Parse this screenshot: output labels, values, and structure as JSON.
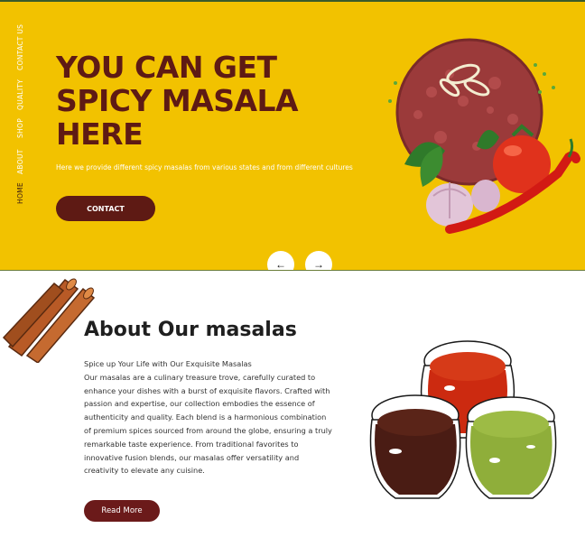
{
  "nav": {
    "items": [
      {
        "label": "HOME",
        "active": true
      },
      {
        "label": "ABOUT",
        "active": false
      },
      {
        "label": "SHOP",
        "active": false
      },
      {
        "label": "QUALITY",
        "active": false
      },
      {
        "label": "CONTACT US",
        "active": false
      }
    ]
  },
  "hero": {
    "title": "YOU CAN GET SPICY MASALA HERE",
    "subtitle": "Here we provide different spicy masalas from various states and from different cultures",
    "contact_label": "CONTACT",
    "prev_icon": "←",
    "next_icon": "→"
  },
  "about": {
    "title": "About Our masalas",
    "tagline": "Spice up Your Life with Our Exquisite Masalas",
    "body": "Our masalas are a culinary treasure trove, carefully curated to enhance your dishes with a burst of exquisite flavors. Crafted with passion and expertise, our collection embodies the essence of authenticity and quality. Each blend is a harmonious combination of premium spices sourced from around the globe, ensuring a truly remarkable taste experience. From traditional favorites to innovative fusion blends, our masalas offer versatility and creativity to elevate any cuisine.",
    "read_more_label": "Read More"
  },
  "colors": {
    "hero_bg": "#f2c200",
    "brand_dark": "#5e1a14",
    "white": "#ffffff"
  }
}
